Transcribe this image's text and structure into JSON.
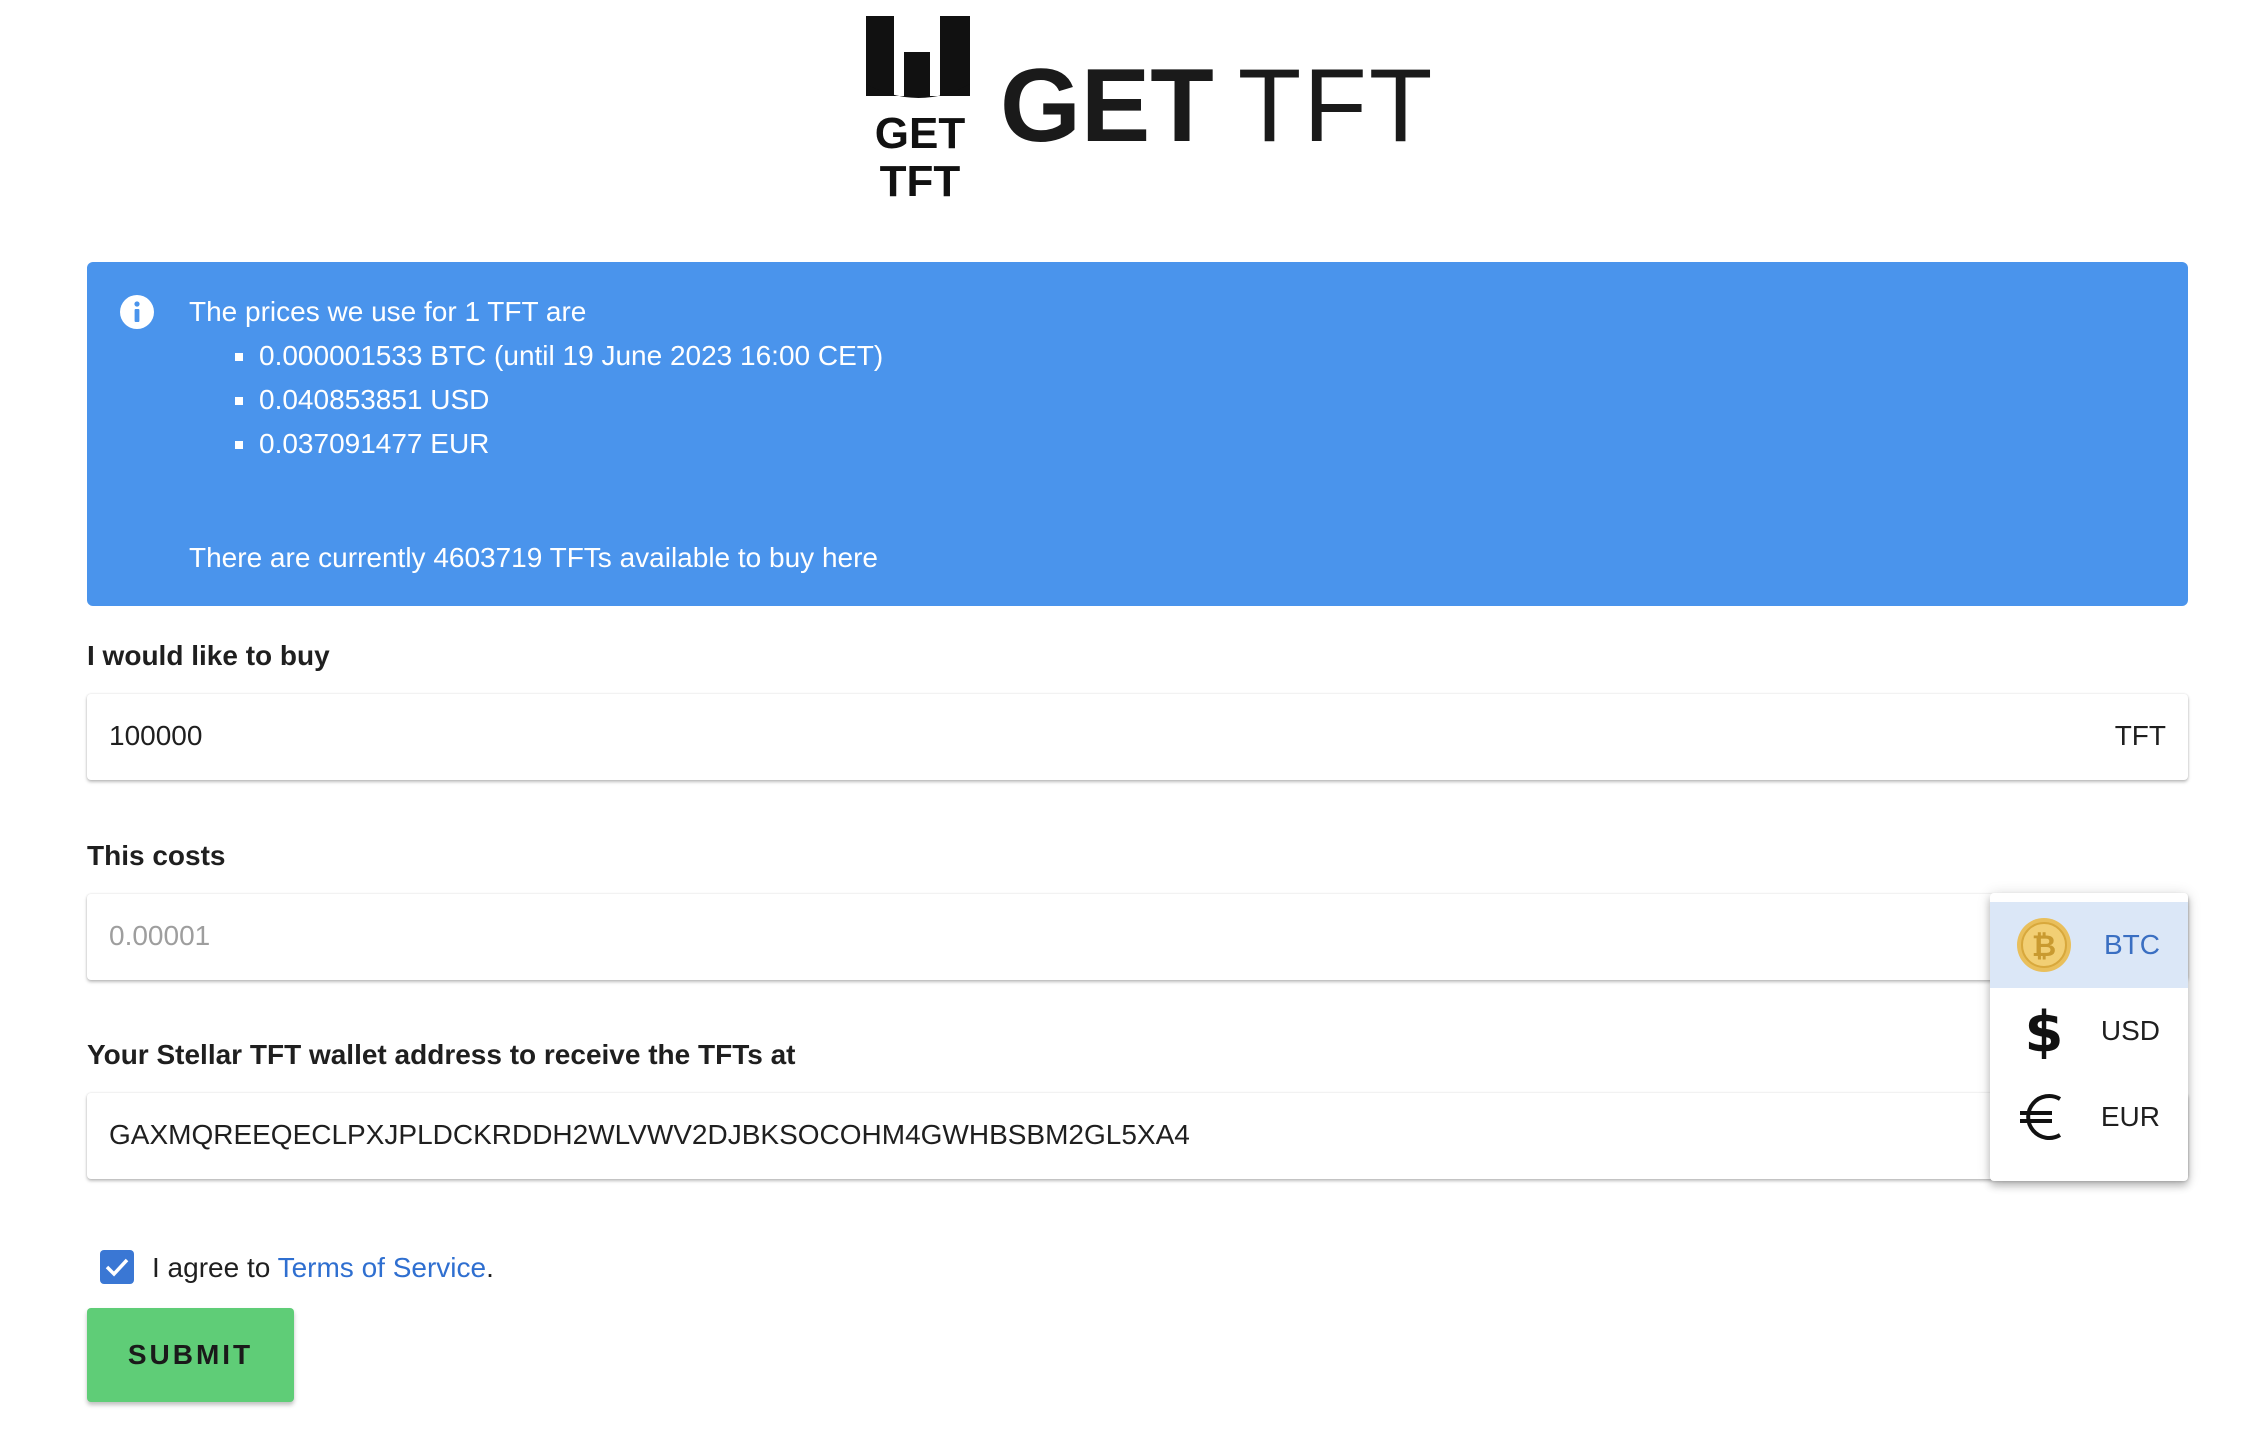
{
  "header": {
    "logo_mark_line1": "GET",
    "logo_mark_line2": "TFT",
    "title_bold": "GET",
    "title_light": "TFT"
  },
  "alert": {
    "icon": "info-icon",
    "intro": "The prices we use for 1 TFT are",
    "prices": [
      "0.000001533 BTC (until 19 June 2023 16:00 CET)",
      "0.040853851 USD",
      "0.037091477 EUR"
    ],
    "availability": "There are currently 4603719 TFTs available to buy here",
    "color": "#4a94ec"
  },
  "buy": {
    "label": "I would like to buy",
    "value": "100000",
    "suffix": "TFT"
  },
  "cost": {
    "label": "This costs",
    "placeholder": "0.00001"
  },
  "currency_menu": {
    "items": [
      {
        "label": "BTC",
        "icon": "bitcoin-icon",
        "selected": true
      },
      {
        "label": "USD",
        "icon": "dollar-icon",
        "selected": false
      },
      {
        "label": "EUR",
        "icon": "euro-icon",
        "selected": false
      }
    ]
  },
  "wallet": {
    "label": "Your Stellar TFT wallet address to receive the TFTs at",
    "value": "GAXMQREEQECLPXJPLDCKRDDH2WLVWV2DJBKSOCOHM4GWHBSBM2GL5XA4"
  },
  "terms": {
    "checked": true,
    "prefix": "I agree to ",
    "link": "Terms of Service",
    "suffix": "."
  },
  "submit_label": "SUBMIT",
  "colors": {
    "submit": "#5fcd77",
    "checkbox": "#3a77d4",
    "link": "#2f6fd0"
  }
}
